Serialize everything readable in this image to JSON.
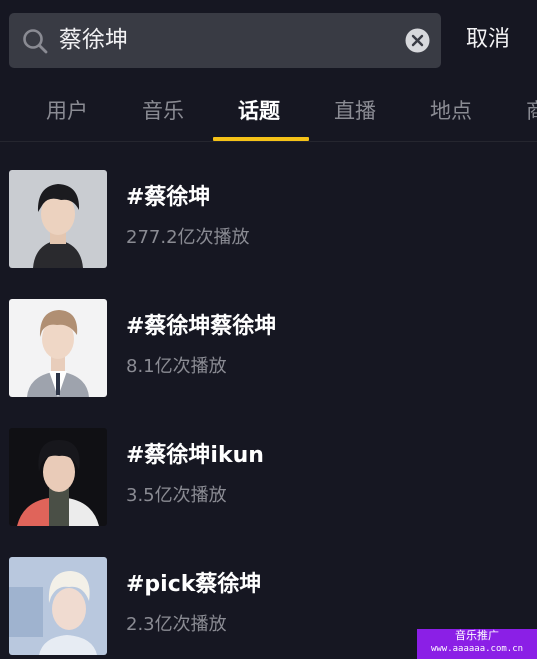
{
  "search": {
    "query": "蔡徐坤",
    "cancel_label": "取消"
  },
  "tabs": [
    {
      "label": "用户",
      "active": false
    },
    {
      "label": "音乐",
      "active": false
    },
    {
      "label": "话题",
      "active": true
    },
    {
      "label": "直播",
      "active": false
    },
    {
      "label": "地点",
      "active": false
    },
    {
      "label": "商",
      "active": false
    }
  ],
  "results": [
    {
      "title": "#蔡徐坤",
      "count": "277.2亿次播放"
    },
    {
      "title": "#蔡徐坤蔡徐坤",
      "count": "8.1亿次播放"
    },
    {
      "title": "#蔡徐坤ikun",
      "count": "3.5亿次播放"
    },
    {
      "title": "#pick蔡徐坤",
      "count": "2.3亿次播放"
    }
  ],
  "promo": {
    "title": "音乐推广",
    "url": "www.aaaaaa.com.cn"
  },
  "colors": {
    "background": "#161722",
    "search_bg": "#393b44",
    "accent": "#f5c218",
    "muted_text": "#8a8b93",
    "promo_bg": "#8b1fe6"
  }
}
